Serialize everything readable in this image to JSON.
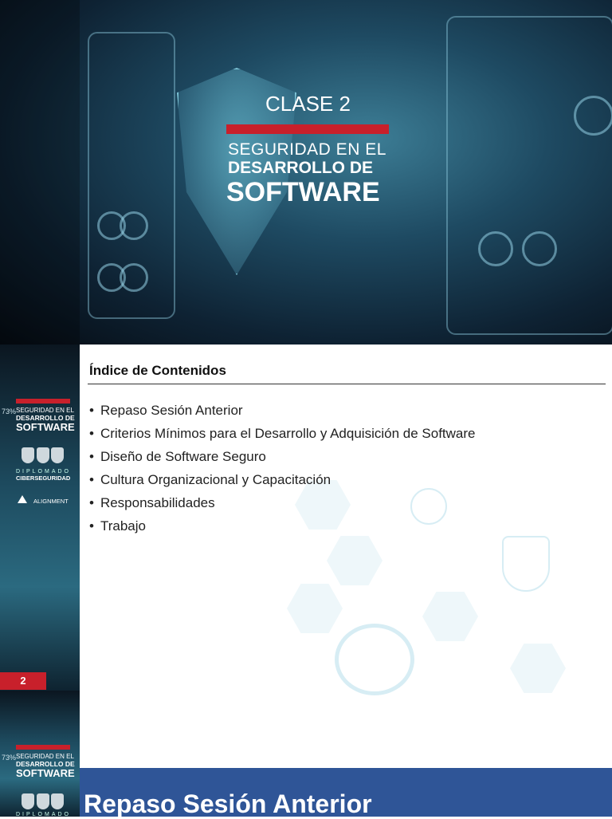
{
  "cover": {
    "class_label": "CLASE 2",
    "subtitle_line1": "SEGURIDAD EN EL",
    "subtitle_line2": "DESARROLLO DE",
    "subtitle_line3": "SOFTWARE"
  },
  "sidebar": {
    "percent": "73%",
    "line1": "SEGURIDAD EN EL",
    "line2": "DESARROLLO DE",
    "line3": "SOFTWARE",
    "diplomado": "DIPLOMADO",
    "ciberseguridad": "CIBERSEGURIDAD",
    "alignment": "ALIGNMENT"
  },
  "slide2": {
    "heading": "Índice de Contenidos",
    "items": [
      "Repaso Sesión Anterior",
      "Criterios Mínimos para el Desarrollo y Adquisición de Software",
      "Diseño de Software Seguro",
      "Cultura Organizacional y Capacitación",
      "Responsabilidades",
      "Trabajo"
    ],
    "page_number": "2"
  },
  "slide3": {
    "title": "Repaso Sesión Anterior"
  },
  "colors": {
    "accent_red": "#c8202b",
    "banner_blue": "#2f5597"
  }
}
